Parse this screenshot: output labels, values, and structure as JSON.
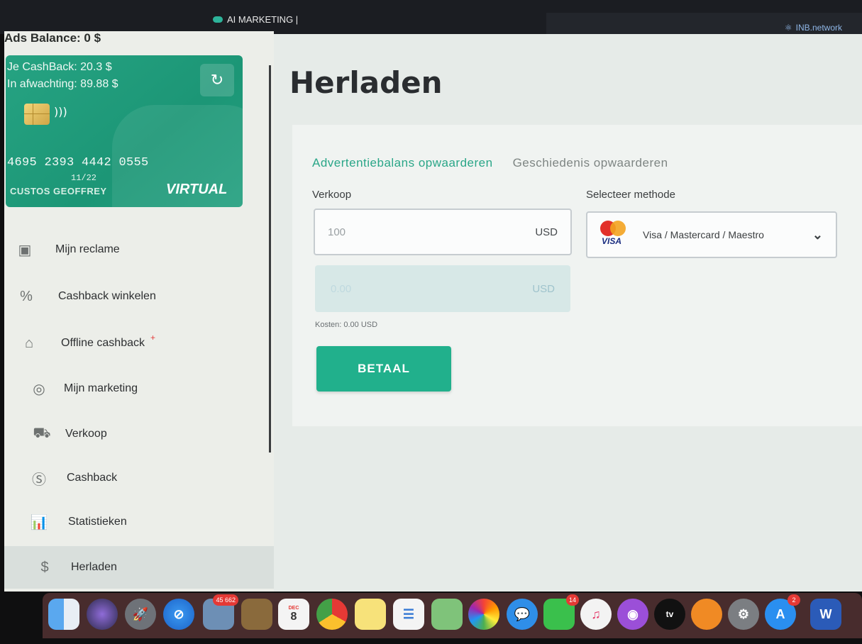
{
  "topbar": {
    "left_tab": "AI MARKETING |",
    "right_site": "INB.network"
  },
  "sidebar": {
    "ads_balance": "Ads Balance: 0 $",
    "card": {
      "cashback": "Je CashBack: 20.3 $",
      "pending": "In afwachting: 89.88 $",
      "number": "4695 2393 4442 0555",
      "expiry": "11/22",
      "holder": "CUSTOS GEOFFREY",
      "type": "VIRTUAL"
    },
    "items": [
      {
        "label": "Mijn reclame",
        "icon": "id-badge-icon"
      },
      {
        "label": "Cashback winkelen",
        "icon": "percent-badge-icon"
      },
      {
        "label": "Offline cashback",
        "icon": "shopping-bag-icon",
        "marker": "+"
      },
      {
        "label": "Mijn marketing",
        "icon": "target-icon"
      },
      {
        "label": "Verkoop",
        "icon": "cart-icon"
      },
      {
        "label": "Cashback",
        "icon": "dollar-circle-icon"
      },
      {
        "label": "Statistieken",
        "icon": "bar-chart-icon"
      },
      {
        "label": "Herladen",
        "icon": "dollar-icon",
        "active": true
      }
    ]
  },
  "main": {
    "title": "Herladen",
    "tabs": [
      "Advertentiebalans opwaarderen",
      "Geschiedenis opwaarderen"
    ],
    "sale_label": "Verkoop",
    "sale_value": "100",
    "sale_currency": "USD",
    "converted_value": "0.00",
    "converted_currency": "USD",
    "fee": "Kosten: 0.00 USD",
    "pay_button": "BETAAL",
    "method_label": "Selecteer methode",
    "method_value": "Visa / Mastercard / Maestro",
    "method_logo_text": "VISA"
  },
  "dock": {
    "photos_badge": "45 662",
    "calendar_month": "DEC",
    "calendar_day": "8",
    "facetime_badge": "14",
    "appstore_badge": "2",
    "tv_label": "tv",
    "word_label": "W"
  },
  "colors": {
    "accent": "#21b08c",
    "card": "#1c9676",
    "tab_active": "#2aa688"
  }
}
